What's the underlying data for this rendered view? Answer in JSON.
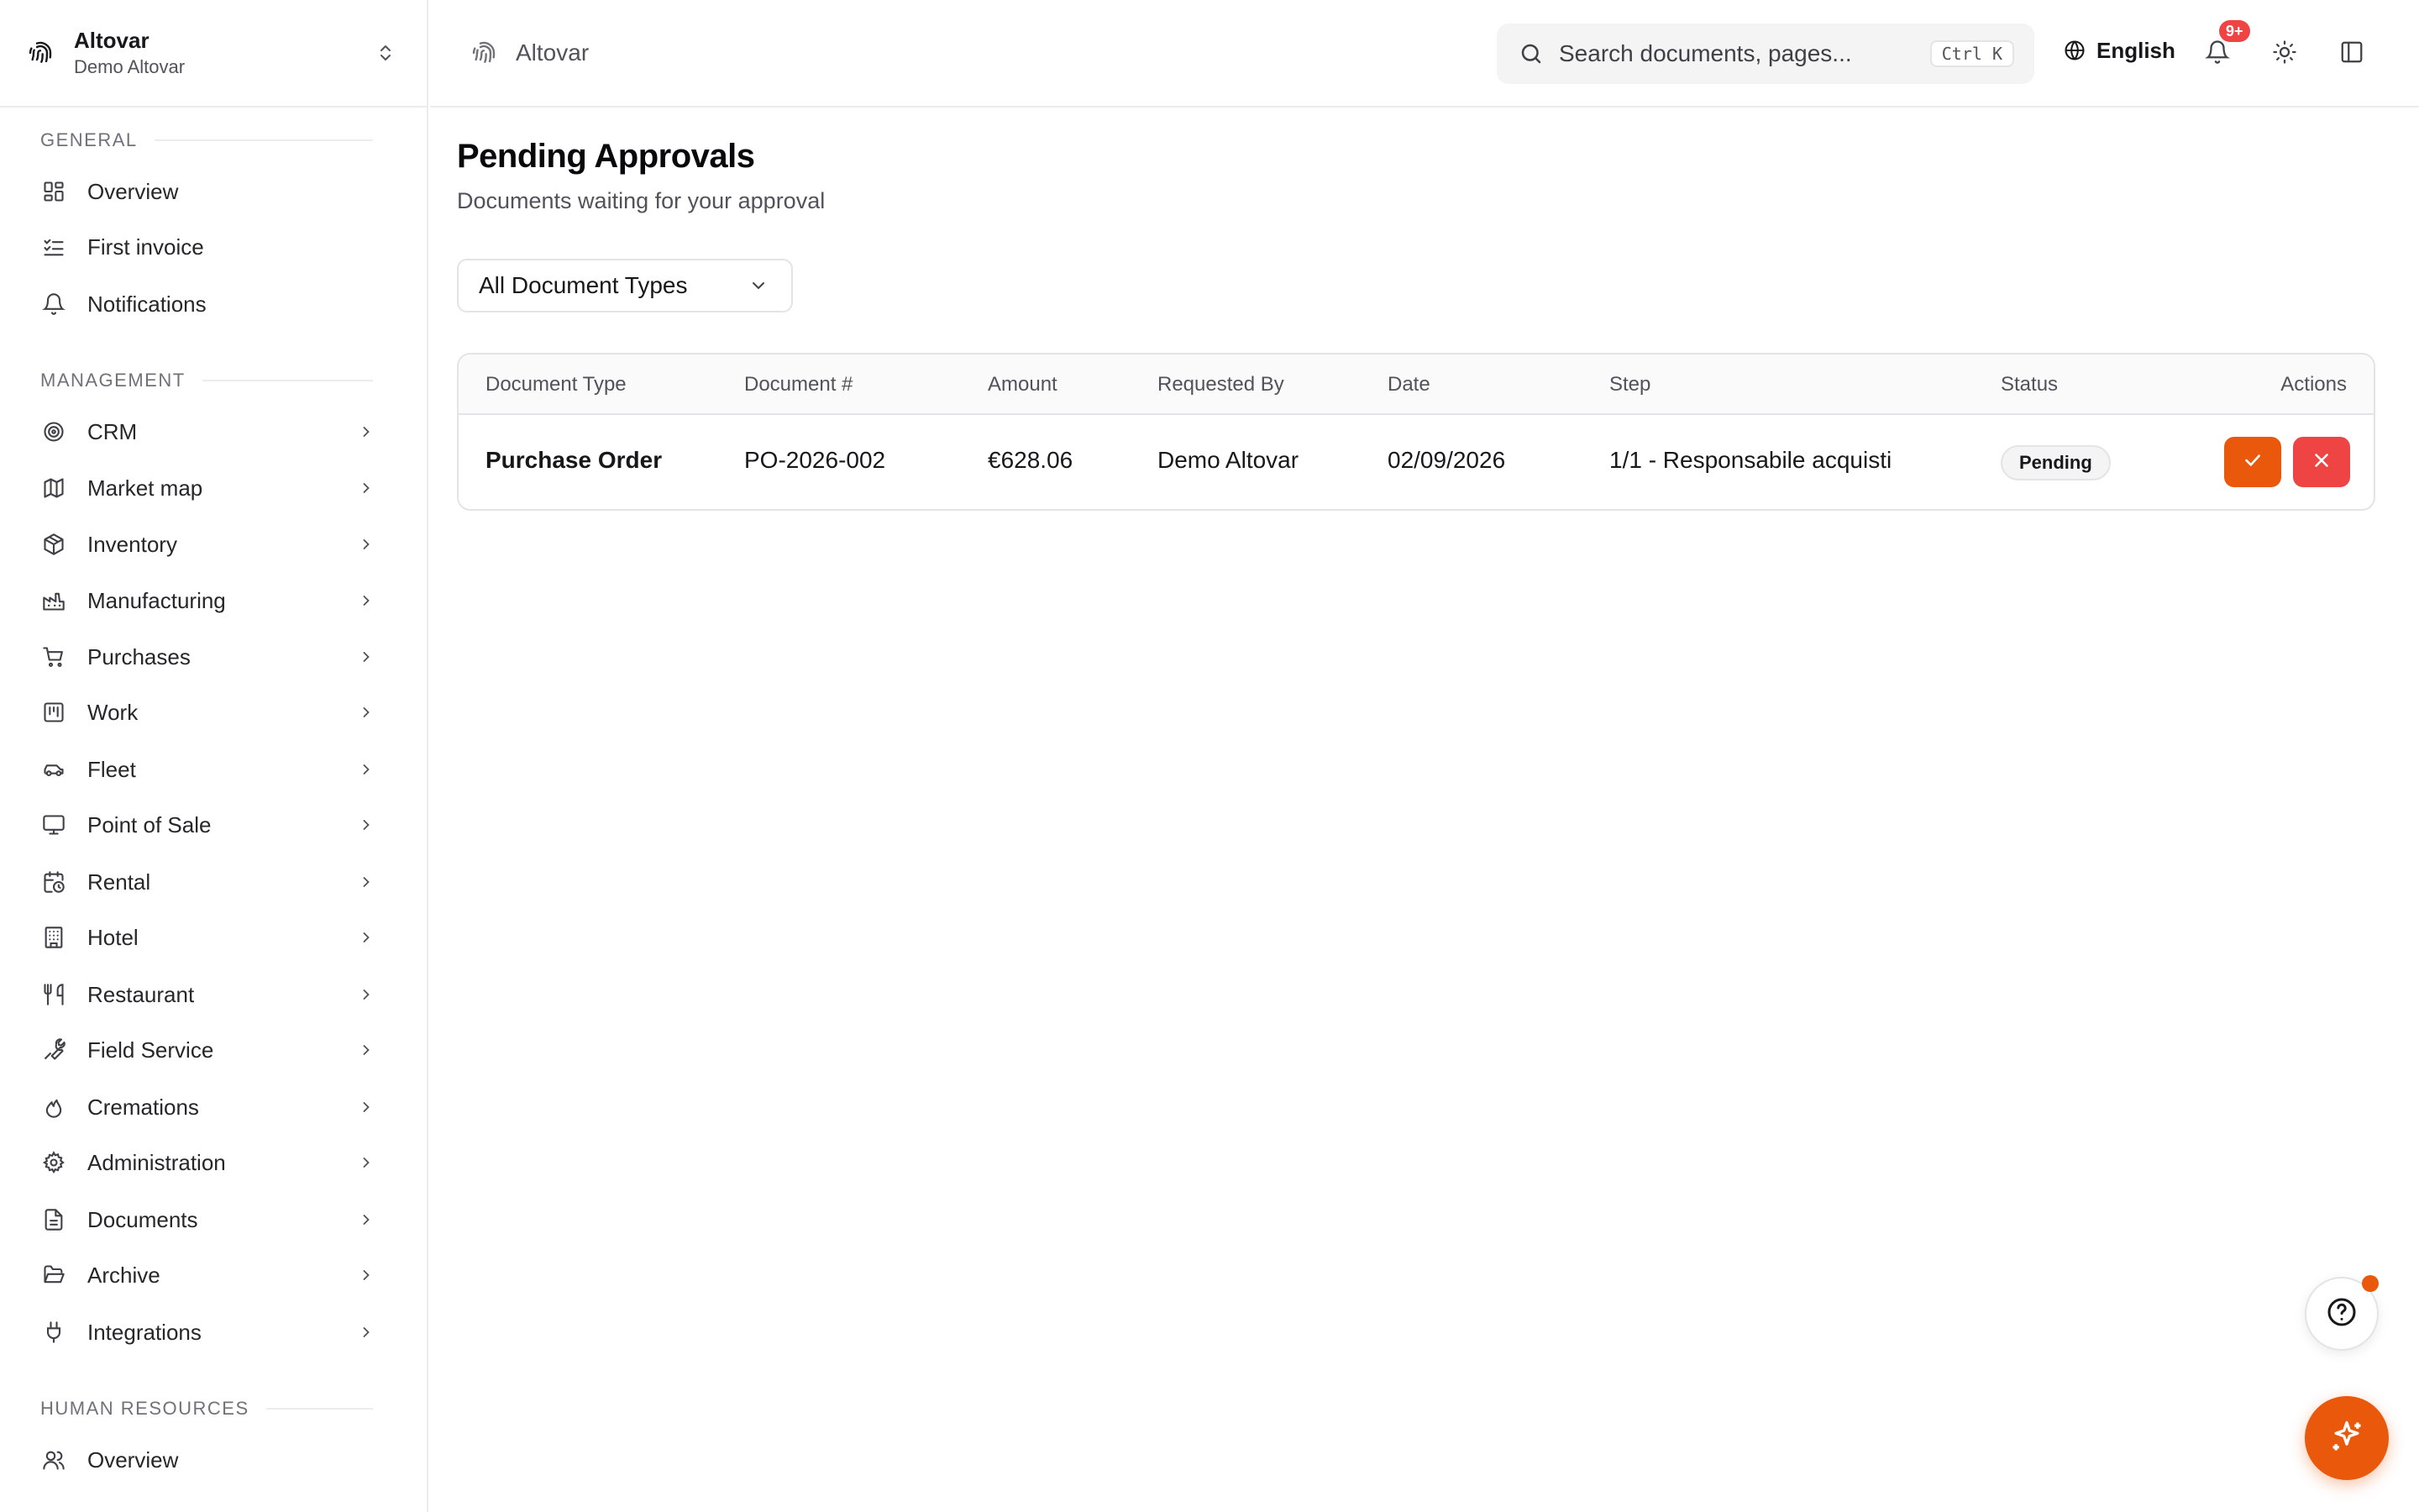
{
  "org": {
    "name": "Altovar",
    "subtitle": "Demo Altovar"
  },
  "sidebar": {
    "sections": [
      {
        "label": "GENERAL"
      },
      {
        "label": "MANAGEMENT"
      },
      {
        "label": "HUMAN RESOURCES"
      }
    ],
    "general": [
      {
        "label": "Overview",
        "icon": "grid-icon"
      },
      {
        "label": "First invoice",
        "icon": "list-check-icon"
      },
      {
        "label": "Notifications",
        "icon": "bell-icon"
      }
    ],
    "management": [
      {
        "label": "CRM",
        "icon": "target-icon"
      },
      {
        "label": "Market map",
        "icon": "map-icon"
      },
      {
        "label": "Inventory",
        "icon": "package-icon"
      },
      {
        "label": "Manufacturing",
        "icon": "factory-icon"
      },
      {
        "label": "Purchases",
        "icon": "cart-icon"
      },
      {
        "label": "Work",
        "icon": "kanban-icon"
      },
      {
        "label": "Fleet",
        "icon": "car-icon"
      },
      {
        "label": "Point of Sale",
        "icon": "monitor-icon"
      },
      {
        "label": "Rental",
        "icon": "calendar-clock-icon"
      },
      {
        "label": "Hotel",
        "icon": "building-icon"
      },
      {
        "label": "Restaurant",
        "icon": "utensils-icon"
      },
      {
        "label": "Field Service",
        "icon": "wrench-icon"
      },
      {
        "label": "Cremations",
        "icon": "flame-icon"
      },
      {
        "label": "Administration",
        "icon": "gear-icon"
      },
      {
        "label": "Documents",
        "icon": "file-icon"
      },
      {
        "label": "Archive",
        "icon": "folder-open-icon"
      },
      {
        "label": "Integrations",
        "icon": "plug-icon"
      }
    ],
    "hr": [
      {
        "label": "Overview",
        "icon": "users-icon"
      }
    ]
  },
  "header": {
    "brand": "Altovar",
    "search_placeholder": "Search documents, pages...",
    "search_shortcut": "Ctrl K",
    "language": "English",
    "notification_badge": "9+"
  },
  "main": {
    "title": "Pending Approvals",
    "subtitle": "Documents waiting for your approval",
    "filter": "All Document Types",
    "table": {
      "columns": [
        "Document Type",
        "Document #",
        "Amount",
        "Requested By",
        "Date",
        "Step",
        "Status",
        "Actions"
      ],
      "rows": [
        {
          "document_type": "Purchase Order",
          "document_number": "PO-2026-002",
          "amount": "€628.06",
          "requested_by": "Demo Altovar",
          "date": "02/09/2026",
          "step": "1/1 - Responsabile acquisti",
          "status": "Pending"
        }
      ]
    }
  },
  "colors": {
    "accent": "#ea580c",
    "danger": "#ef4444",
    "border": "#e4e4e7"
  }
}
